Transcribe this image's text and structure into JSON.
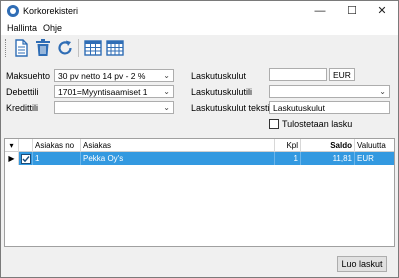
{
  "window": {
    "title": "Korkorekisteri"
  },
  "menu": {
    "items": [
      "Hallinta",
      "Ohje"
    ]
  },
  "form": {
    "maksuehto": {
      "label": "Maksuehto",
      "value": "30 pv netto 14 pv - 2 %"
    },
    "debettili": {
      "label": "Debettili",
      "value": "1701=Myyntisaamiset 1"
    },
    "kredittili": {
      "label": "Kredittili",
      "value": ""
    },
    "laskutuskulut": {
      "label": "Laskutuskulut",
      "value": "",
      "currency": "EUR"
    },
    "laskutuskulutili": {
      "label": "Laskutuskulutili",
      "value": ""
    },
    "laskutuskulut_teksti": {
      "label": "Laskutuskulut teksti",
      "value": "Laskutuskulut"
    },
    "tulostetaan_lasku": {
      "label": "Tulostetaan lasku",
      "checked": false
    }
  },
  "grid": {
    "columns": [
      "",
      "Asiakas no",
      "Asiakas",
      "Kpl",
      "Saldo",
      "Valuutta"
    ],
    "rows": [
      {
        "marker": "▶",
        "checked": true,
        "asiakas_no": "1",
        "asiakas": "Pekka Oy's",
        "kpl": "1",
        "saldo": "11,81",
        "valuutta": "EUR"
      }
    ]
  },
  "buttons": {
    "luo_laskut": "Luo laskut"
  },
  "colors": {
    "selection": "#3399e0",
    "icon_blue": "#2f6db5"
  }
}
